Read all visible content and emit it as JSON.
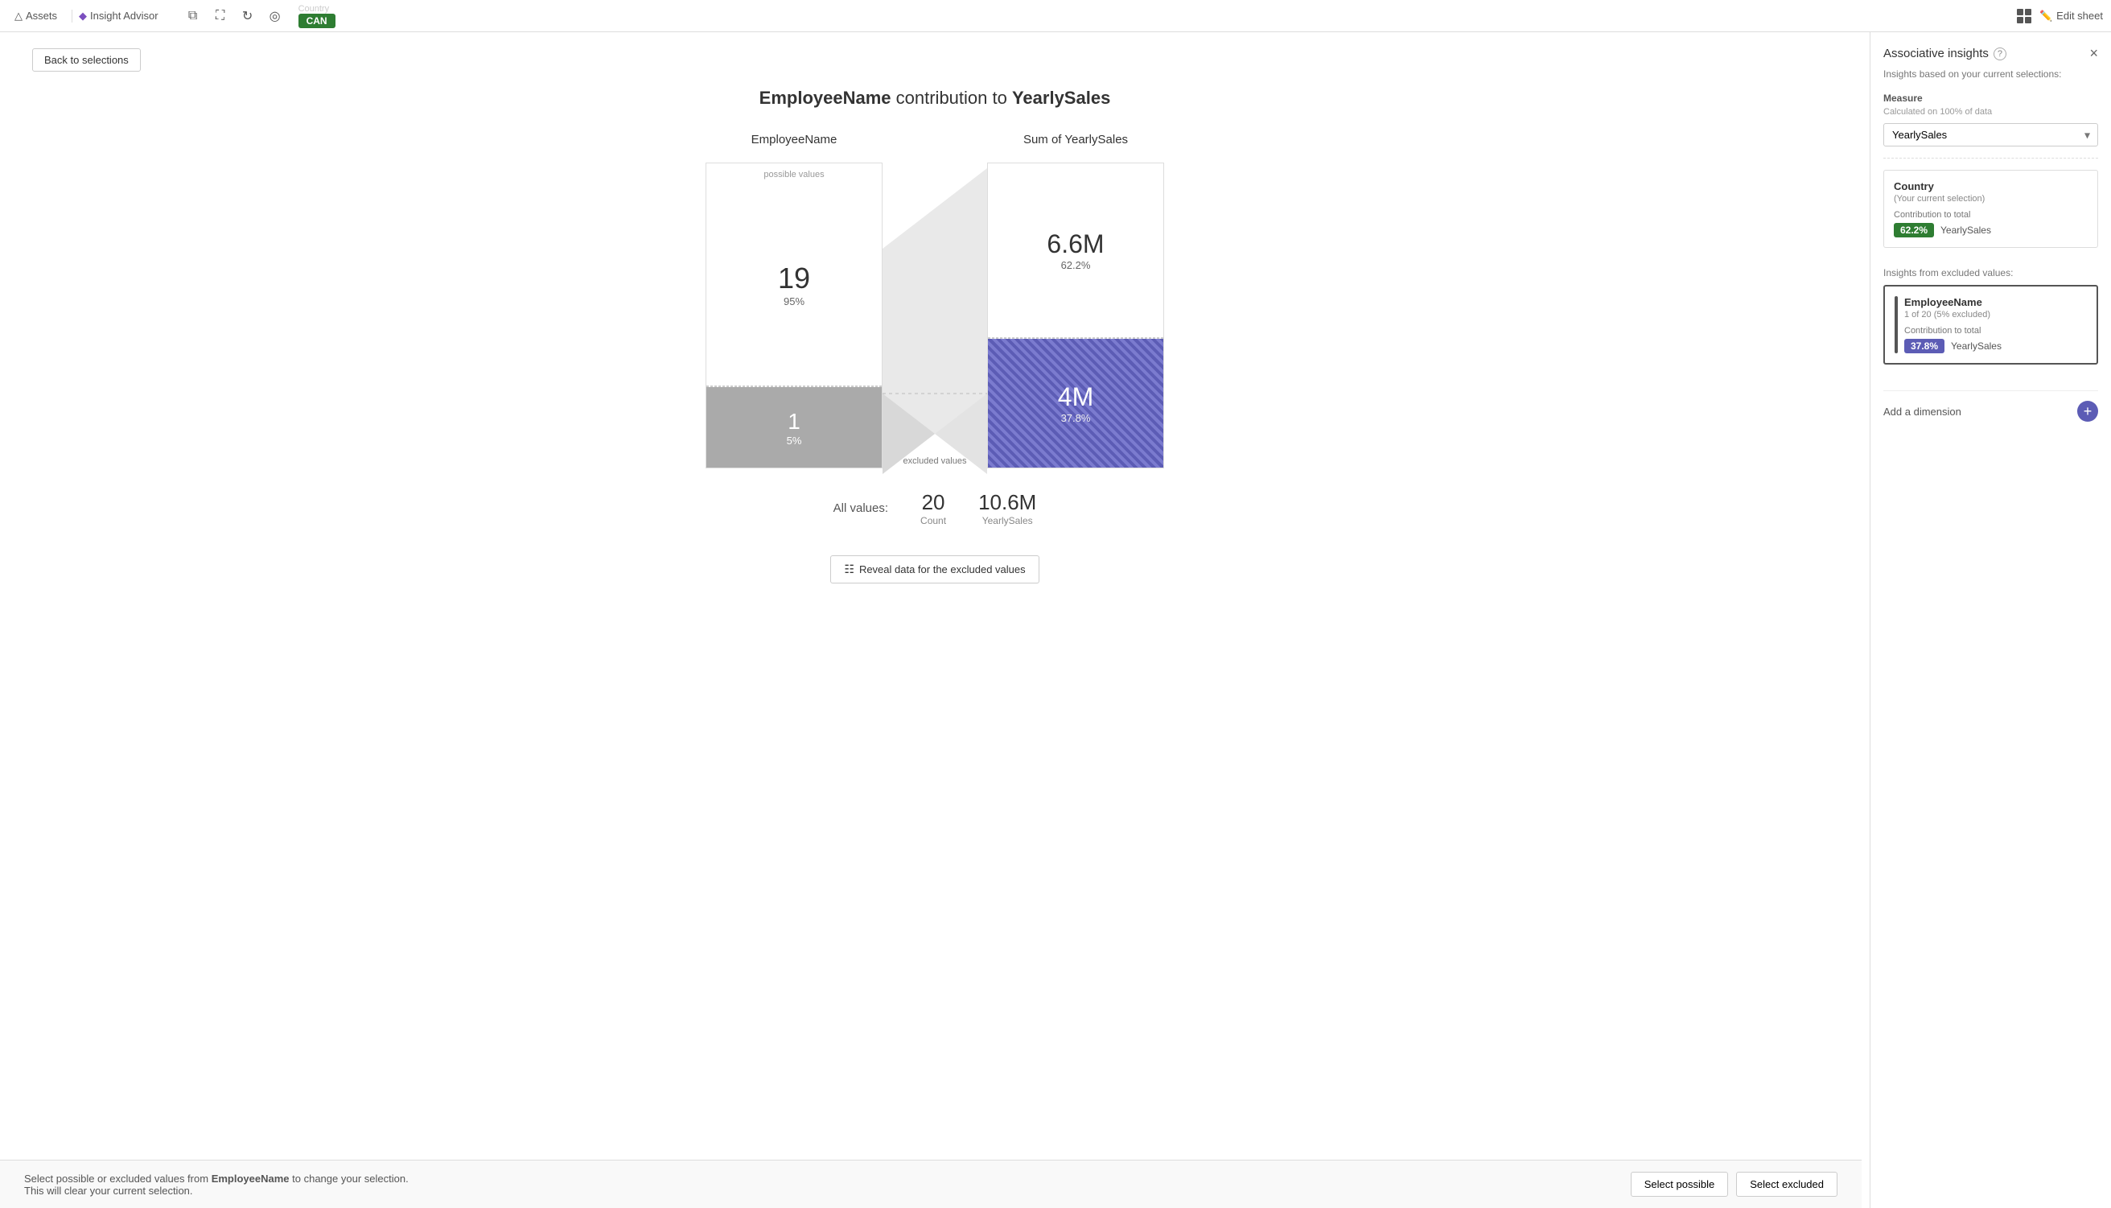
{
  "topbar": {
    "assets_label": "Assets",
    "insight_advisor_label": "Insight Advisor",
    "country_pill_label": "Country",
    "country_pill_value": "CAN",
    "edit_sheet_label": "Edit sheet"
  },
  "back_button_label": "Back to selections",
  "chart": {
    "title_part1": "EmployeeName",
    "title_connector": " contribution to ",
    "title_part2": "YearlySales",
    "left_header": "EmployeeName",
    "right_header": "Sum of YearlySales",
    "possible_label": "possible values",
    "excluded_label": "excluded values",
    "possible_count": "19",
    "possible_pct": "95%",
    "excluded_count": "1",
    "excluded_pct": "5%",
    "right_top_value": "6.6M",
    "right_top_pct": "62.2%",
    "right_bottom_value": "4M",
    "right_bottom_pct": "37.8%",
    "all_values_label": "All values:",
    "all_count": "20",
    "all_count_sub": "Count",
    "all_yearly": "10.6M",
    "all_yearly_sub": "YearlySales"
  },
  "reveal_button_label": "Reveal data for the excluded values",
  "bottom_bar": {
    "text": "Select possible or excluded values from",
    "bold_name": "EmployeeName",
    "text2": "to change your selection. This will clear your current selection.",
    "select_possible_label": "Select possible",
    "select_excluded_label": "Select excluded"
  },
  "sidebar": {
    "title": "Associative insights",
    "subtitle": "Insights based on your current selections:",
    "close_icon": "×",
    "measure_section_label": "Measure",
    "measure_sub_label": "Calculated on 100% of data",
    "measure_value": "YearlySales",
    "country_card": {
      "title": "Country",
      "sub": "(Your current selection)",
      "contrib_label": "Contribution to total",
      "badge_pct": "62.2%",
      "badge_name": "YearlySales"
    },
    "excl_insights_label": "Insights from excluded values:",
    "employee_card": {
      "title": "EmployeeName",
      "sub": "1 of 20 (5% excluded)",
      "contrib_label": "Contribution to total",
      "badge_pct": "37.8%",
      "badge_name": "YearlySales"
    },
    "add_dimension_label": "Add a dimension"
  }
}
